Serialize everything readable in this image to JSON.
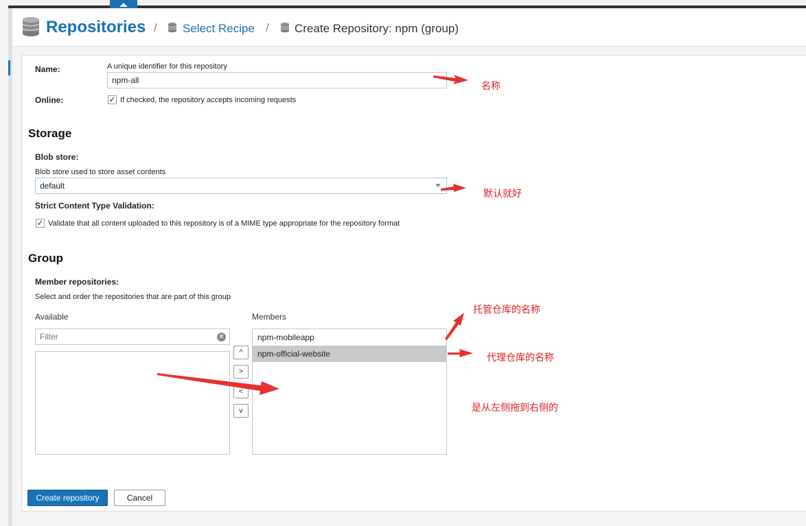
{
  "header": {
    "title": "Repositories",
    "separator": "/",
    "crumb_select_recipe": "Select Recipe",
    "crumb_current": "Create Repository: npm (group)"
  },
  "form": {
    "name_label": "Name:",
    "name_help": "A unique identifier for this repository",
    "name_value": "npm-all",
    "online_label": "Online:",
    "online_help": "If checked, the repository accepts incoming requests",
    "online_checked": true
  },
  "storage": {
    "section_title": "Storage",
    "blob_label": "Blob store:",
    "blob_help": "Blob store used to store asset contents",
    "blob_value": "default",
    "strict_label": "Strict Content Type Validation:",
    "strict_help": "Validate that all content uploaded to this repository is of a MIME type appropriate for the repository format",
    "strict_checked": true
  },
  "group": {
    "section_title": "Group",
    "members_label": "Member repositories:",
    "members_help": "Select and order the repositories that are part of this group",
    "available_label": "Available",
    "members_col_label": "Members",
    "filter_placeholder": "Filter",
    "members": [
      "npm-mobileapp",
      "npm-official-website"
    ],
    "selected_member": "npm-official-website",
    "move_buttons": {
      "up": "^",
      "right": ">",
      "left": "<",
      "down": "v"
    }
  },
  "actions": {
    "create_label": "Create repository",
    "cancel_label": "Cancel"
  },
  "annotations": {
    "name_note": "名称",
    "default_note": "默认就好",
    "hosted_note": "托管仓库的名称",
    "proxy_note": "代理仓库的名称",
    "drag_note": "是从左侧拖到右侧的"
  },
  "colors": {
    "brand": "#1a72b5",
    "annotation": "#e02020",
    "selected_row": "#c9c9c9"
  }
}
